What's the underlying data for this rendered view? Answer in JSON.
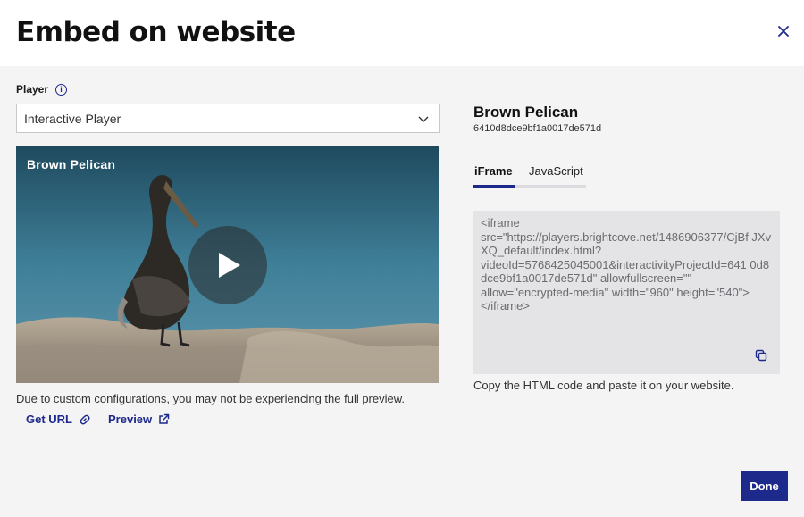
{
  "dialog": {
    "title": "Embed on website",
    "close_icon": "close-icon"
  },
  "player": {
    "label": "Player",
    "info_icon": "info-icon",
    "selected": "Interactive Player",
    "preview_title": "Brown Pelican",
    "note": "Due to custom configurations, you may not be experiencing the full preview.",
    "links": {
      "get_url": "Get URL",
      "preview": "Preview"
    }
  },
  "video": {
    "name": "Brown Pelican",
    "id": "6410d8dce9bf1a0017de571d"
  },
  "tabs": [
    {
      "label": "iFrame",
      "active": true
    },
    {
      "label": "JavaScript",
      "active": false
    }
  ],
  "code": "<iframe\nsrc=\"https://players.brightcove.net/1486906377/CjBf JXvXQ_default/index.html?\nvideoId=5768425045001&interactivityProjectId=641 0d8dce9bf1a0017de571d\" allowfullscreen=\"\"\nallow=\"encrypted-media\" width=\"960\" height=\"540\">\n</iframe>",
  "copy_note": "Copy the HTML code and paste it on your website.",
  "done_label": "Done",
  "colors": {
    "accent": "#1d2a8c",
    "background": "#f4f4f5",
    "code_bg": "#e4e4e7"
  }
}
